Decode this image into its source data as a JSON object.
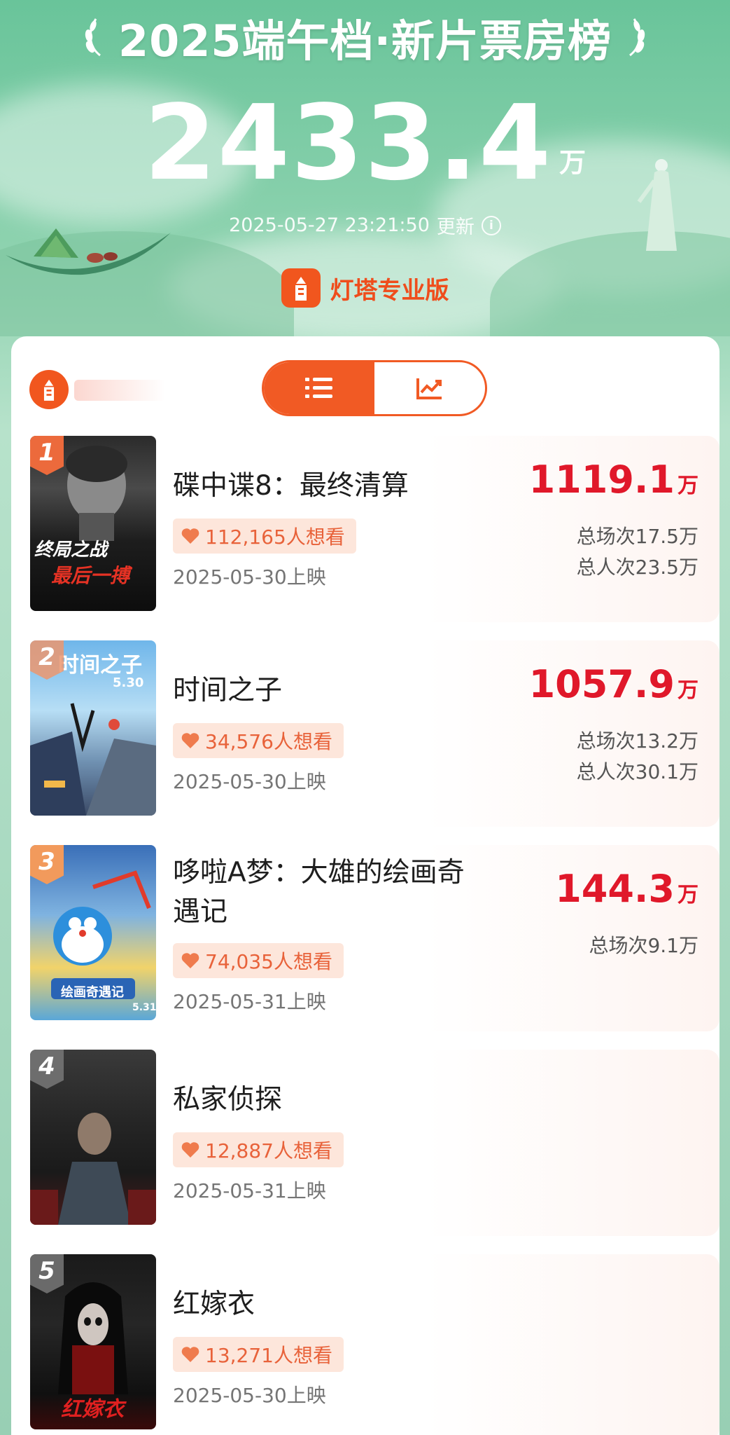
{
  "header": {
    "title": "2025端午档·新片票房榜",
    "total_value": "2433.4",
    "total_unit": "万",
    "update_time": "2025-05-27 23:21:50",
    "update_label": "更新",
    "brand_name": "灯塔专业版"
  },
  "colors": {
    "accent": "#f15a24",
    "gross_red": "#e0182a",
    "header_green": "#69c49a"
  },
  "toggle": {
    "options": [
      "list-icon",
      "trend-chart-icon"
    ],
    "selected": "list-icon"
  },
  "movies": [
    {
      "rank": "1",
      "name": "碟中谍8：最终清算",
      "want": "112,165人想看",
      "release": "2025-05-30上映",
      "gross": "1119.1",
      "gross_unit": "万",
      "sessions": "总场次17.5万",
      "viewers": "总人次23.5万",
      "poster_text_1": "终局之战",
      "poster_text_2": "最后一搏"
    },
    {
      "rank": "2",
      "name": "时间之子",
      "want": "34,576人想看",
      "release": "2025-05-30上映",
      "gross": "1057.9",
      "gross_unit": "万",
      "sessions": "总场次13.2万",
      "viewers": "总人次30.1万",
      "poster_text_1": "时间之子",
      "poster_text_2": "5.30"
    },
    {
      "rank": "3",
      "name": "哆啦A梦：大雄的绘画奇遇记",
      "want": "74,035人想看",
      "release": "2025-05-31上映",
      "gross": "144.3",
      "gross_unit": "万",
      "sessions": "总场次9.1万",
      "poster_text_1": "绘画奇遇记",
      "poster_text_2": "5.31"
    },
    {
      "rank": "4",
      "name": "私家侦探",
      "want": "12,887人想看",
      "release": "2025-05-31上映"
    },
    {
      "rank": "5",
      "name": "红嫁衣",
      "want": "13,271人想看",
      "release": "2025-05-30上映",
      "poster_text_1": "红嫁衣"
    }
  ]
}
